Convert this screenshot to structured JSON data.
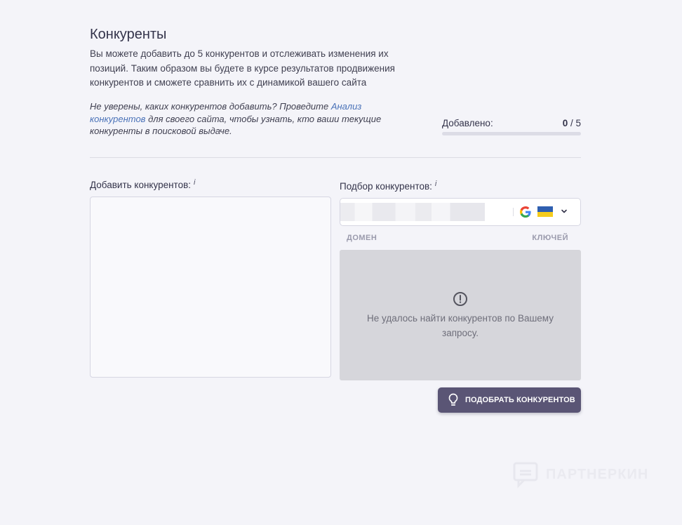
{
  "header": {
    "title": "Конкуренты",
    "description": "Вы можете добавить до 5 конкурентов и отслеживать изменения их позиций. Таким образом вы будете в курсе результатов продвижения конкурентов и сможете сравнить их с динамикой вашего сайта",
    "hint_before": "Не уверены, каких конкурентов добавить? Проведите ",
    "hint_link": "Анализ конкурентов",
    "hint_after": " для своего сайта, чтобы узнать, кто ваши текущие конкуренты в поисковой выдаче."
  },
  "counter": {
    "label": "Добавлено:",
    "current": "0",
    "separator": " / ",
    "max": "5",
    "progress": 0
  },
  "add_panel": {
    "label": "Добавить конкурентов:",
    "info": "i",
    "textarea_value": ""
  },
  "pick_panel": {
    "label": "Подбор конкурентов:",
    "info": "i",
    "search_engine_icon": "google-icon",
    "region_icon": "ukraine-flag-icon",
    "columns": {
      "domain": "ДОМЕН",
      "keys": "КЛЮЧЕЙ"
    },
    "empty_icon": "exclamation-circle-icon",
    "empty_message": "Не удалось найти конкурентов по Вашему запросу."
  },
  "button": {
    "label": "ПОДОБРАТЬ КОНКУРЕНТОВ",
    "icon": "lightbulb-icon"
  },
  "watermark": {
    "text": "ПАРТНЕРКИН"
  },
  "colors": {
    "background": "#f4f4f9",
    "accent": "#5a5575",
    "link": "#4a72b8",
    "empty_panel": "#d6d6db",
    "flag_blue": "#2f5fb0",
    "flag_yellow": "#f5cc1d"
  }
}
